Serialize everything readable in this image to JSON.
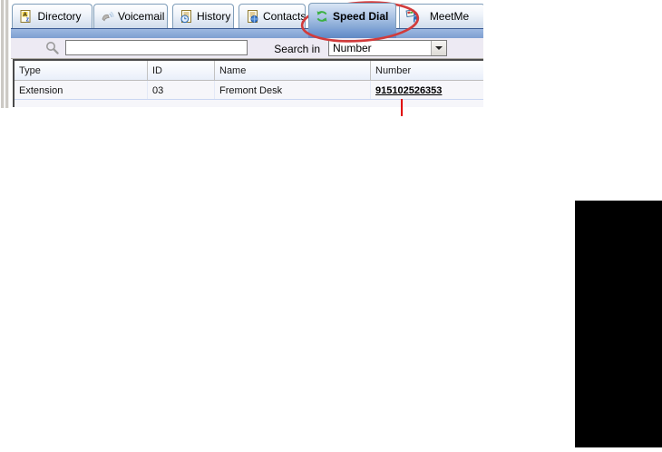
{
  "tabs": {
    "items": [
      {
        "label": "Directory",
        "icon": "directory-icon",
        "selected": false
      },
      {
        "label": "Voicemail",
        "icon": "voicemail-icon",
        "selected": false
      },
      {
        "label": "History",
        "icon": "history-icon",
        "selected": false
      },
      {
        "label": "Contacts",
        "icon": "contacts-icon",
        "selected": false
      },
      {
        "label": "Speed Dial",
        "icon": "speed-dial-icon",
        "selected": true
      },
      {
        "label": "MeetMe",
        "icon": "meetme-icon",
        "selected": false
      }
    ]
  },
  "toolbar": {
    "search_icon": "magnifier-icon",
    "search_value": "",
    "search_in_label": "Search in",
    "search_in_selected": "Number"
  },
  "table": {
    "columns": [
      "Type",
      "ID",
      "Name",
      "Number"
    ],
    "rows": [
      {
        "type": "Extension",
        "id": "03",
        "name": "Fremont Desk",
        "number": "915102526353"
      }
    ]
  },
  "annotations": {
    "highlight": "red ellipse around Speed Dial tab",
    "highlight_color": "#d23b3b",
    "callout_line_color": "#e10000",
    "redaction_color": "#000000"
  },
  "colors": {
    "selected_tab": "#7fa3d3",
    "band": "#7e9fd1",
    "toolbar_bg": "#edeaf3",
    "speed_dial_icon_green": "#3cb043"
  }
}
